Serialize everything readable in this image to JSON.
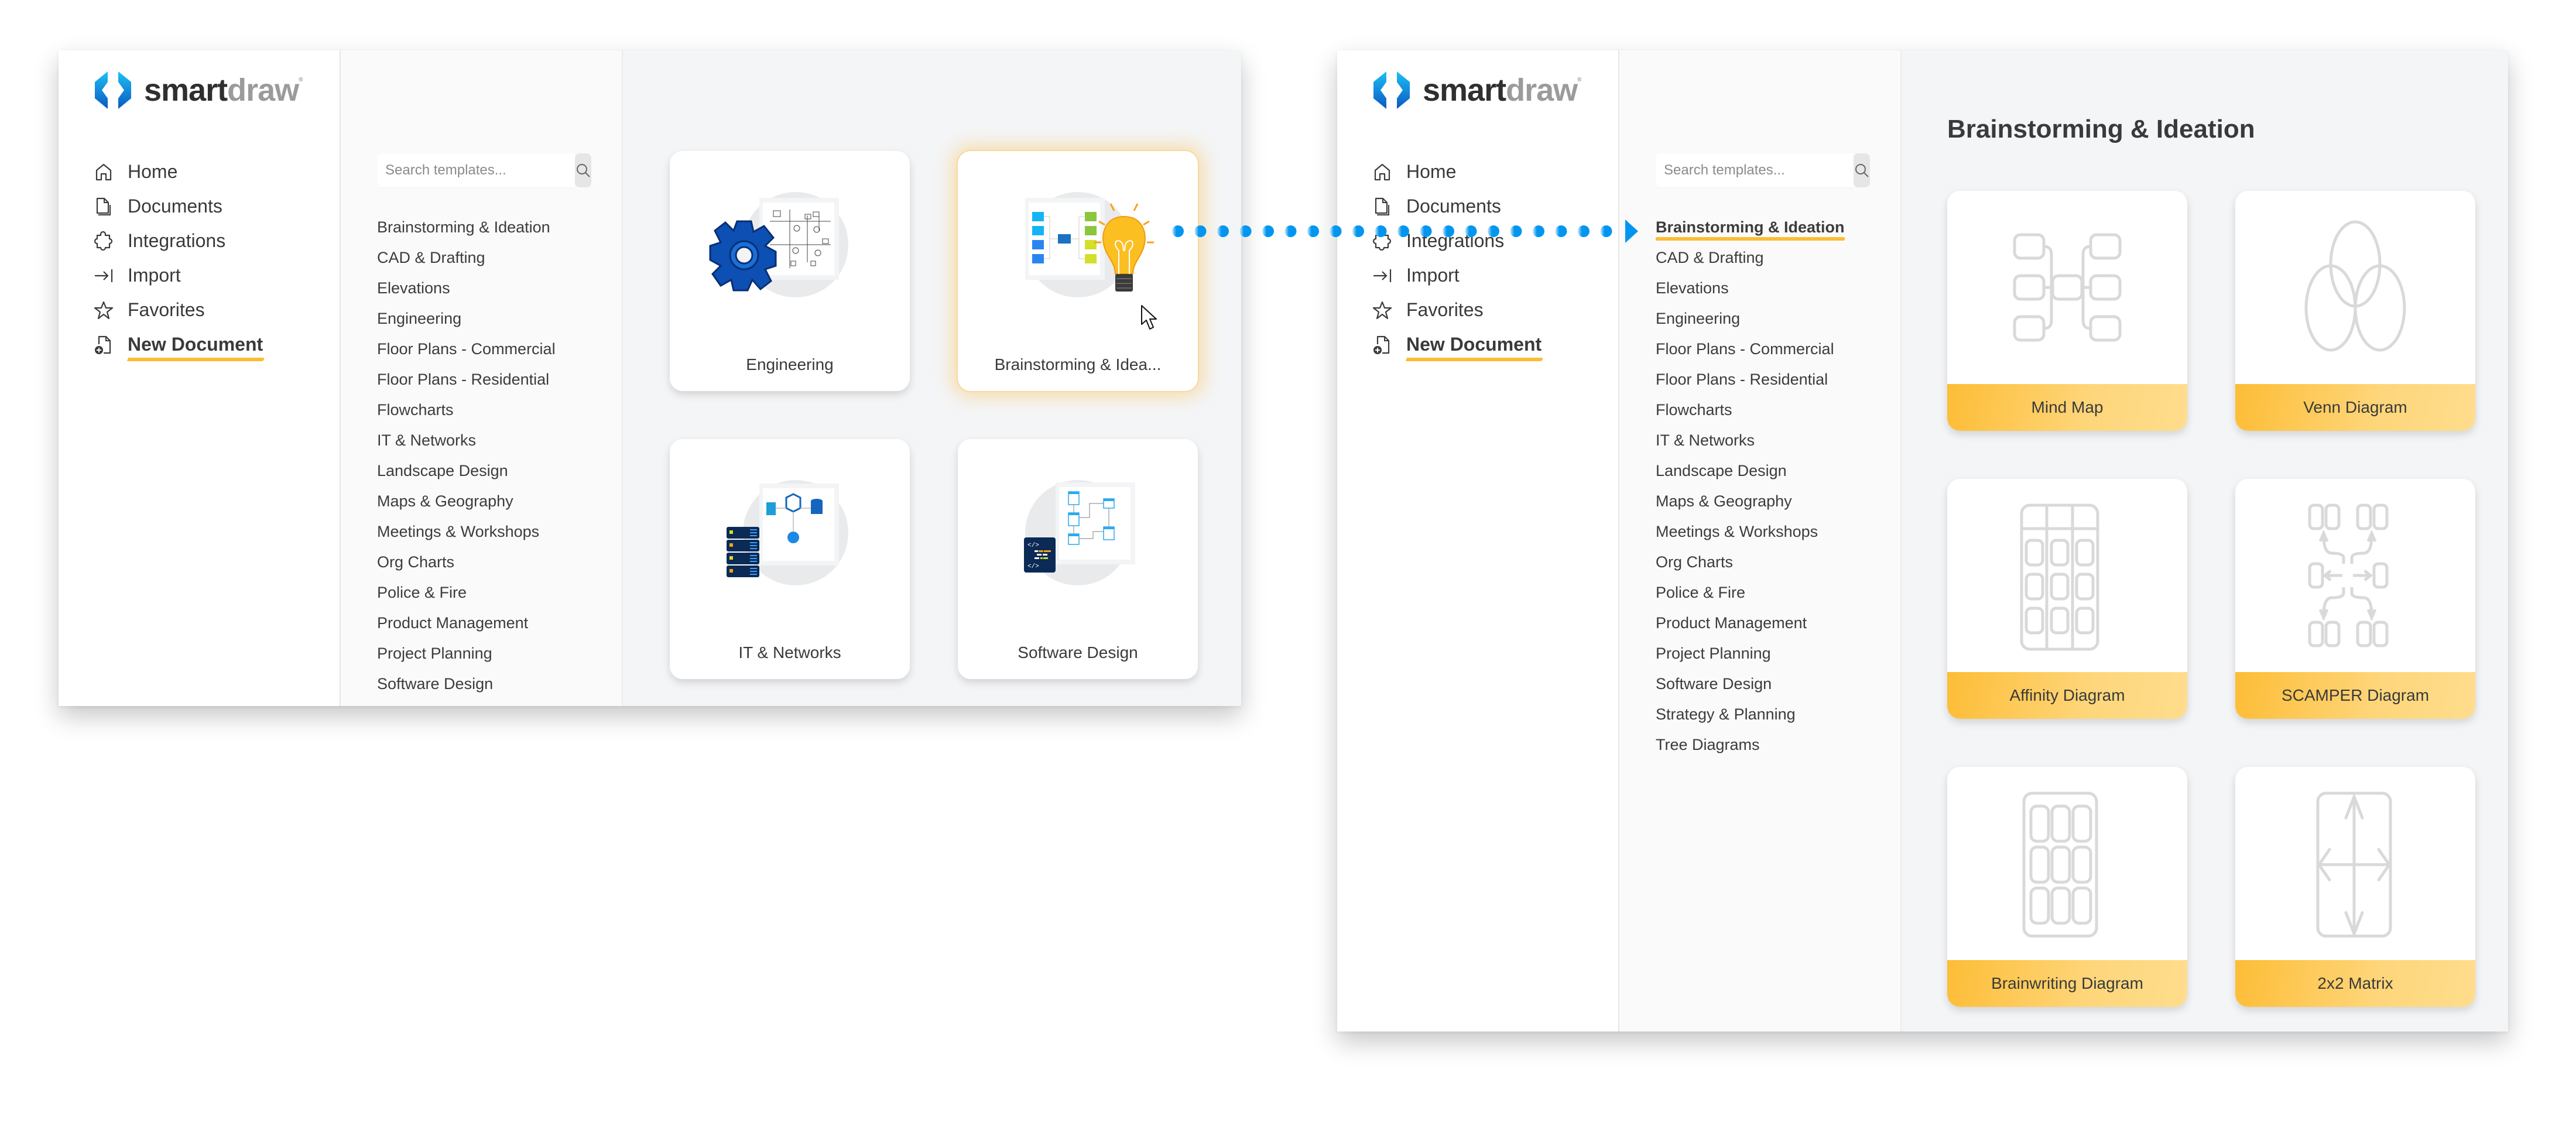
{
  "brand": {
    "name_part1": "smart",
    "name_part2": "draw",
    "reg": "®"
  },
  "nav": {
    "items": [
      {
        "label": "Home",
        "icon": "home-icon"
      },
      {
        "label": "Documents",
        "icon": "documents-icon"
      },
      {
        "label": "Integrations",
        "icon": "puzzle-icon"
      },
      {
        "label": "Import",
        "icon": "import-icon"
      },
      {
        "label": "Favorites",
        "icon": "star-icon"
      },
      {
        "label": "New Document",
        "icon": "new-document-icon",
        "active": true
      }
    ]
  },
  "search": {
    "placeholder": "Search templates...",
    "value": ""
  },
  "left_window": {
    "categories": [
      "Brainstorming & Ideation",
      "CAD & Drafting",
      "Elevations",
      "Engineering",
      "Floor Plans - Commercial",
      "Floor Plans - Residential",
      "Flowcharts",
      "IT & Networks",
      "Landscape Design",
      "Maps & Geography",
      "Meetings & Workshops",
      "Org Charts",
      "Police & Fire",
      "Product Management",
      "Project Planning",
      "Software Design"
    ],
    "cards": [
      {
        "label": "Engineering",
        "icon": "engineering-gear-icon"
      },
      {
        "label": "Brainstorming & Idea...",
        "icon": "lightbulb-mindmap-icon",
        "highlighted": true
      },
      {
        "label": "IT & Networks",
        "icon": "server-network-icon"
      },
      {
        "label": "Software Design",
        "icon": "code-erd-icon"
      }
    ]
  },
  "right_window": {
    "title": "Brainstorming & Ideation",
    "active_category": "Brainstorming & Ideation",
    "categories": [
      "Brainstorming & Ideation",
      "CAD & Drafting",
      "Elevations",
      "Engineering",
      "Floor Plans - Commercial",
      "Floor Plans - Residential",
      "Flowcharts",
      "IT & Networks",
      "Landscape Design",
      "Maps & Geography",
      "Meetings & Workshops",
      "Org Charts",
      "Police & Fire",
      "Product Management",
      "Project Planning",
      "Software Design",
      "Strategy & Planning",
      "Tree Diagrams"
    ],
    "templates": [
      {
        "label": "Mind Map",
        "icon": "mind-map-icon"
      },
      {
        "label": "Venn Diagram",
        "icon": "venn-diagram-icon"
      },
      {
        "label": "Affinity Diagram",
        "icon": "affinity-diagram-icon"
      },
      {
        "label": "SCAMPER Diagram",
        "icon": "scamper-diagram-icon"
      },
      {
        "label": "Brainwriting Diagram",
        "icon": "brainwriting-diagram-icon"
      },
      {
        "label": "2x2 Matrix",
        "icon": "matrix-2x2-icon"
      }
    ]
  },
  "colors": {
    "accent": "#fbbd33",
    "flow_arrow": "#0096f0",
    "logo_blue": "#1a73d9"
  }
}
